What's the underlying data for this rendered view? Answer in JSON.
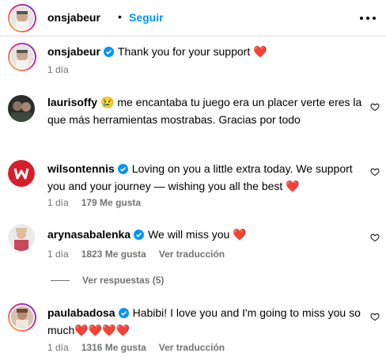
{
  "header": {
    "username": "onsjabeur",
    "separator": "•",
    "follow_label": "Seguir"
  },
  "comments": [
    {
      "username": "onsjabeur",
      "verified": true,
      "text": "Thank you for your support ❤️",
      "time": "1 día"
    },
    {
      "username": "laurisoffy",
      "verified": false,
      "text": "😢 me encantaba tu juego era un placer verte eres la que más herramientas mostrabas. Gracias por todo"
    },
    {
      "username": "wilsontennis",
      "verified": true,
      "text": "Loving on you a little extra today. We support you and your journey — wishing you all the best ❤️",
      "time": "1 día",
      "likes": "179 Me gusta"
    },
    {
      "username": "arynasabalenka",
      "verified": true,
      "text": "We will miss you ❤️",
      "time": "1 día",
      "likes": "1823 Me gusta",
      "translate": "Ver traducción"
    },
    {
      "username": "paulabadosa",
      "verified": true,
      "text": "Habibi! I love you and I'm going to miss you so much❤️❤️❤️❤️",
      "time": "1 día",
      "likes": "1316 Me gusta",
      "translate": "Ver traducción"
    }
  ],
  "replies_label": "Ver respuestas (5)",
  "colors": {
    "accent_blue": "#0095f6",
    "muted": "#737373",
    "verified": "#0095f6",
    "heart": "#ed4956"
  }
}
